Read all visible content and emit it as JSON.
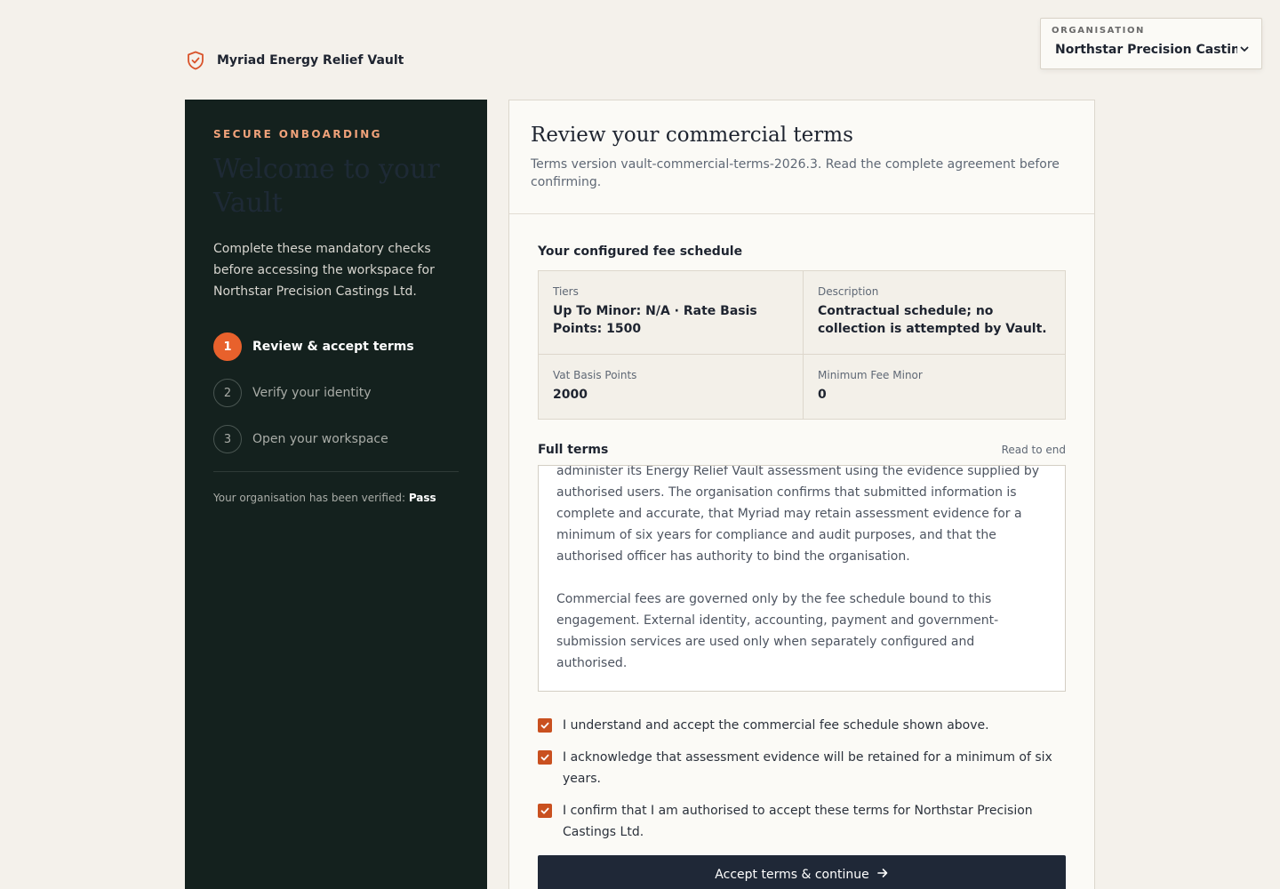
{
  "brand": {
    "name": "Myriad Energy Relief Vault",
    "icon": "shield-check-icon",
    "accent": "#d9532a"
  },
  "org": {
    "label": "ORGANISATION",
    "value": "Northstar Precision Castings Ltd."
  },
  "sidebar": {
    "eyebrow": "SECURE ONBOARDING",
    "welcome": "Welcome to your Vault",
    "intro": "Complete these mandatory checks before accessing the workspace for Northstar Precision Castings Ltd.",
    "steps": [
      {
        "num": "1",
        "label": "Review & accept terms",
        "active": true
      },
      {
        "num": "2",
        "label": "Verify your identity",
        "active": false
      },
      {
        "num": "3",
        "label": "Open your workspace",
        "active": false
      }
    ],
    "verified_prefix": "Your organisation has been verified:",
    "verified_value": "Pass"
  },
  "card": {
    "title": "Review your commercial terms",
    "subtitle": "Terms version vault-commercial-terms-2026.3. Read the complete agreement before confirming.",
    "fee_section_title": "Your configured fee schedule",
    "fees": [
      {
        "key": "Tiers",
        "value": "Up To Minor: N/A · Rate Basis Points: 1500"
      },
      {
        "key": "Description",
        "value": "Contractual schedule; no collection is attempted by Vault."
      },
      {
        "key": "Vat Basis Points",
        "value": "2000"
      },
      {
        "key": "Minimum Fee Minor",
        "value": "0"
      }
    ],
    "terms_title": "Full terms",
    "terms_status": "Read to end",
    "terms_paragraphs": [
      "administer its Energy Relief Vault assessment using the evidence supplied by authorised users. The organisation confirms that submitted information is complete and accurate, that Myriad may retain assessment evidence for a minimum of six years for compliance and audit purposes, and that the authorised officer has authority to bind the organisation.",
      "Commercial fees are governed only by the fee schedule bound to this engagement. External identity, accounting, payment and government-submission services are used only when separately configured and authorised."
    ],
    "checks": [
      {
        "label": "I understand and accept the commercial fee schedule shown above.",
        "checked": true
      },
      {
        "label": "I acknowledge that assessment evidence will be retained for a minimum of six years.",
        "checked": true
      },
      {
        "label": "I confirm that I am authorised to accept these terms for Northstar Precision Castings Ltd.",
        "checked": true
      }
    ],
    "cta_label": "Accept terms & continue"
  }
}
